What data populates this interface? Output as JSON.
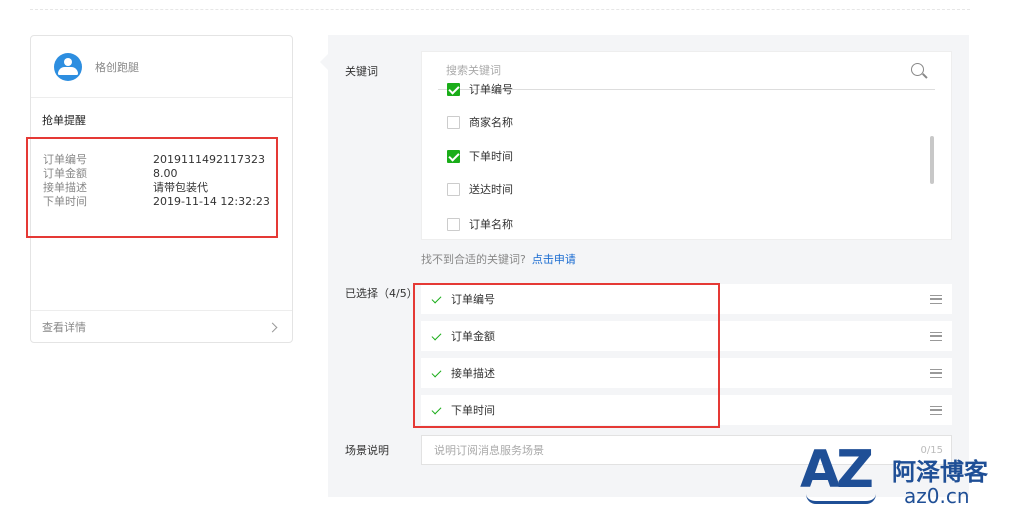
{
  "preview": {
    "account_name": "格创跑腿",
    "title": "抢单提醒",
    "fields": [
      {
        "key": "订单编号",
        "value": "2019111492117323"
      },
      {
        "key": "订单金额",
        "value": "8.00"
      },
      {
        "key": "接单描述",
        "value": "请带包装代"
      },
      {
        "key": "下单时间",
        "value": "2019-11-14 12:32:23"
      }
    ],
    "footer": "查看详情"
  },
  "settings": {
    "keyword_label": "关键词",
    "search_placeholder": "搜索关键词",
    "options": [
      {
        "label": "订单编号",
        "checked": true
      },
      {
        "label": "商家名称",
        "checked": false
      },
      {
        "label": "下单时间",
        "checked": true
      },
      {
        "label": "送达时间",
        "checked": false
      },
      {
        "label": "订单名称",
        "checked": false
      }
    ],
    "hint": "找不到合适的关键词?",
    "hint_link": "点击申请",
    "selected_label": "已选择（4/5）",
    "selected": [
      "订单编号",
      "订单金额",
      "接单描述",
      "下单时间"
    ],
    "scene_label": "场景说明",
    "scene_placeholder": "说明订阅消息服务场景",
    "scene_counter": "0/15"
  },
  "watermark": {
    "logo": "AZ",
    "name": "阿泽博客",
    "domain": "az0.cn"
  },
  "colors": {
    "accent_green": "#1aad19",
    "highlight_red": "#e53935",
    "link_blue": "#1a6cd1",
    "brand_blue": "#1f4f96"
  }
}
